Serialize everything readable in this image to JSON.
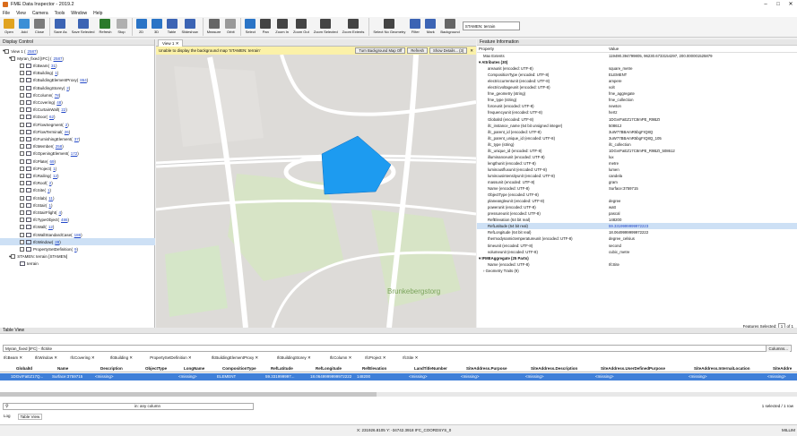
{
  "app": {
    "title": "FME Data Inspector - 2019.2",
    "win": [
      "–",
      "□",
      "✕"
    ]
  },
  "menu": [
    "File",
    "View",
    "Camera",
    "Tools",
    "Window",
    "Help"
  ],
  "toolbar": {
    "buttons": [
      {
        "label": "Open",
        "icon": "folder-open-icon",
        "color": "#e0a320"
      },
      {
        "label": "Add",
        "icon": "add-dataset-icon",
        "color": "#3b8fd6"
      },
      {
        "label": "Close",
        "icon": "close-dataset-icon",
        "color": "#7b7b7b"
      },
      {
        "label": "Save As",
        "icon": "save-as-icon",
        "color": "#3c64b4"
      },
      {
        "label": "Save Selected",
        "icon": "save-selected-icon",
        "color": "#3c64b4"
      },
      {
        "label": "Refresh",
        "icon": "refresh-icon",
        "color": "#2c7a2c"
      },
      {
        "label": "Stop",
        "icon": "stop-icon",
        "color": "#b0b0b0"
      },
      {
        "label": "2D",
        "icon": "2d-view-icon",
        "color": "#2a74c6"
      },
      {
        "label": "3D",
        "icon": "3d-view-icon",
        "color": "#2a74c6"
      },
      {
        "label": "Table",
        "icon": "table-icon",
        "color": "#3c64b4"
      },
      {
        "label": "Slideshow",
        "icon": "slideshow-icon",
        "color": "#3c64b4"
      },
      {
        "label": "Measure",
        "icon": "measure-icon",
        "color": "#666"
      },
      {
        "label": "Orbit",
        "icon": "orbit-icon",
        "color": "#999"
      },
      {
        "label": "Select",
        "icon": "select-icon",
        "color": "#2a74c6"
      },
      {
        "label": "Pan",
        "icon": "pan-icon",
        "color": "#444"
      },
      {
        "label": "Zoom In",
        "icon": "zoom-in-icon",
        "color": "#444"
      },
      {
        "label": "Zoom Out",
        "icon": "zoom-out-icon",
        "color": "#444"
      },
      {
        "label": "Zoom Selected",
        "icon": "zoom-selected-icon",
        "color": "#444"
      },
      {
        "label": "Zoom Extents",
        "icon": "zoom-extents-icon",
        "color": "#444"
      },
      {
        "label": "Select No Geometry",
        "icon": "no-geometry-icon",
        "color": "#444"
      },
      {
        "label": "Filter",
        "icon": "filter-icon",
        "color": "#3c64b4"
      },
      {
        "label": "Mark",
        "icon": "mark-icon",
        "color": "#3c64b4"
      },
      {
        "label": "Background",
        "icon": "background-icon",
        "color": "#666"
      }
    ],
    "bg_combo": "STAMEN: terrain"
  },
  "display_control": {
    "title": "Display Control",
    "view": "View 1 (",
    "view_count": "2587",
    "dataset": "Myran_fixed [IFC] (",
    "dataset_count": "2587",
    "items": [
      {
        "name": "IfcBeam",
        "count": "31"
      },
      {
        "name": "IfcBuilding",
        "count": "1"
      },
      {
        "name": "IfcBuildingElementProxy",
        "count": "864"
      },
      {
        "name": "IfcBuildingStorey",
        "count": "2"
      },
      {
        "name": "IfcColumn",
        "count": "78"
      },
      {
        "name": "IfcCovering",
        "count": "48"
      },
      {
        "name": "IfcCurtainWall",
        "count": "22"
      },
      {
        "name": "IfcDoor",
        "count": "62"
      },
      {
        "name": "IfcFlowSegment",
        "count": "2"
      },
      {
        "name": "IfcFlowTerminal",
        "count": "26"
      },
      {
        "name": "IfcFurnishingElement",
        "count": "37"
      },
      {
        "name": "IfcMember",
        "count": "258"
      },
      {
        "name": "IfcOpeningElement",
        "count": "172"
      },
      {
        "name": "IfcPlate",
        "count": "69"
      },
      {
        "name": "IfcProject",
        "count": "1"
      },
      {
        "name": "IfcRailing",
        "count": "12"
      },
      {
        "name": "IfcRoof",
        "count": "2"
      },
      {
        "name": "IfcSite",
        "count": "1"
      },
      {
        "name": "IfcSlab",
        "count": "11"
      },
      {
        "name": "IfcStair",
        "count": "1"
      },
      {
        "name": "IfcStairFlight",
        "count": "4"
      },
      {
        "name": "IfcTypeObject",
        "count": "486"
      },
      {
        "name": "IfcWall",
        "count": "12"
      },
      {
        "name": "IfcWallStandardCase",
        "count": "186"
      },
      {
        "name": "IfcWindow",
        "count": "28"
      },
      {
        "name": "PropertySetDefinition",
        "count": "9"
      }
    ],
    "stamen": "STAMEN: terrain [STAMEN]",
    "stamen_child": "terrain"
  },
  "map": {
    "tab": "View 1",
    "message": "Unable to display the background map 'STAMEN: terrain'",
    "btn_off": "Turn Background Map Off",
    "btn_refresh": "Refresh",
    "btn_details": "Show Details... (3)",
    "place": "Brunkebergstorg"
  },
  "feature_info": {
    "title": "Feature Information",
    "col_prop": "Property",
    "col_val": "Value",
    "rows": [
      {
        "k": "Max Extents",
        "v": "119490.394799805, 96230.6733154297, 200.000001525879",
        "l": 1
      },
      {
        "k": "▾ Attributes (30)",
        "v": "",
        "l": 0,
        "b": 1
      },
      {
        "k": "areaunit (encoded: UTF-8)",
        "v": "square_metre",
        "l": 2
      },
      {
        "k": "CompositionType (encoded: UTF-8)",
        "v": "ELEMENT",
        "l": 2
      },
      {
        "k": "electriccurrentunit (encoded: UTF-8)",
        "v": "ampere",
        "l": 2
      },
      {
        "k": "electricvoltageunit (encoded: UTF-8)",
        "v": "volt",
        "l": 2
      },
      {
        "k": "fme_geometry (string)",
        "v": "fme_aggregate",
        "l": 2
      },
      {
        "k": "fme_type (string)",
        "v": "fme_collection",
        "l": 2
      },
      {
        "k": "forceunit (encoded: UTF-8)",
        "v": "newton",
        "l": 2
      },
      {
        "k": "frequencyunit (encoded: UTF-8)",
        "v": "hertz",
        "l": 2
      },
      {
        "k": "GlobalId (encoded: UTF-8)",
        "v": "1DGvrFaEZ17C8mPE_R9BZI",
        "l": 2
      },
      {
        "k": "ifc_instance_name (64 bit unsigned integer)",
        "v": "508612",
        "l": 2
      },
      {
        "k": "ifc_parent_id (encoded: UTF-8)",
        "v": "3uW77BBAmR5bgFrQ8Q",
        "l": 2
      },
      {
        "k": "ifc_parent_unique_id (encoded: UTF-8)",
        "v": "3uW77BBAmR5bgFrQ8Q_105",
        "l": 2
      },
      {
        "k": "ifc_type (string)",
        "v": "ifc_collection",
        "l": 2
      },
      {
        "k": "ifc_unique_id (encoded: UTF-8)",
        "v": "1DGvrFaEZ17C8mPE_R9BZI_508612",
        "l": 2
      },
      {
        "k": "illuminanceunit (encoded: UTF-8)",
        "v": "lux",
        "l": 2
      },
      {
        "k": "lengthunit (encoded: UTF-8)",
        "v": "metre",
        "l": 2
      },
      {
        "k": "luminousfluxunit (encoded: UTF-8)",
        "v": "lumen",
        "l": 2
      },
      {
        "k": "luminousintensityunit (encoded: UTF-8)",
        "v": "candela",
        "l": 2
      },
      {
        "k": "massunit (encoded: UTF-8)",
        "v": "gram",
        "l": 2
      },
      {
        "k": "Name (encoded: UTF-8)",
        "v": "Surface:3759715",
        "l": 2
      },
      {
        "k": "ObjectType (encoded: UTF-8)",
        "v": "",
        "l": 2
      },
      {
        "k": "planeangleunit (encoded: UTF-8)",
        "v": "degree",
        "l": 2
      },
      {
        "k": "powerunit (encoded: UTF-8)",
        "v": "watt",
        "l": 2
      },
      {
        "k": "pressureunit (encoded: UTF-8)",
        "v": "pascal",
        "l": 2
      },
      {
        "k": "RefElevation (64 bit real)",
        "v": "148200",
        "l": 2
      },
      {
        "k": "RefLatitude (64 bit real)",
        "v": "59.3319999999972223",
        "l": 2,
        "s": 1
      },
      {
        "k": "RefLongitude (64 bit real)",
        "v": "18.0649999999972222",
        "l": 2
      },
      {
        "k": "thermodynamictemperatureunit (encoded: UTF-8)",
        "v": "degree_celsius",
        "l": 2
      },
      {
        "k": "timeunit (encoded: UTF-8)",
        "v": "second",
        "l": 2
      },
      {
        "k": "volumeunit (encoded: UTF-8)",
        "v": "cubic_metre",
        "l": 2
      },
      {
        "k": "▾ IFMEAggregate (25 Parts)",
        "v": "",
        "l": 0,
        "b": 1
      },
      {
        "k": "Name (encoded: UTF-8)",
        "v": "IfcSite",
        "l": 2
      },
      {
        "k": "› Geometry Traits (9)",
        "v": "",
        "l": 1
      }
    ],
    "selected_label": "Features Selected:",
    "sel_num": "1",
    "sel_of": "of 1"
  },
  "table_view": {
    "title": "Table View",
    "source": "Myran_fixed [IFC] - IfcSite",
    "columns_btn": "Columns...",
    "tabs": [
      "IfcBeam",
      "IfcWindow",
      "IfcCovering",
      "IfcBuilding",
      "PropertySetDefinition",
      "IfcBuildingElementProxy",
      "IfcBuildingStorey",
      "IfcColumn",
      "IfcProject",
      "IfcSite"
    ],
    "headers": [
      "GlobalId",
      "Name",
      "Description",
      "ObjectType",
      "LongName",
      "CompositionType",
      "RefLatitude",
      "RefLongitude",
      "RefElevation",
      "LandTitleNumber",
      "SiteAddress.Purpose",
      "SiteAddress.Description",
      "SiteAddress.UserDefinedPurpose",
      "SiteAddress.InternalLocation",
      "SiteAddre"
    ],
    "row": [
      "1DGvrFaEZ17Q...",
      "Surface:3759715",
      "<missing>",
      "",
      "<missing>",
      "ELEMENT",
      "59.331999997...",
      "18.0649999999972222",
      "148200",
      "<missing>",
      "<missing>",
      "<missing>",
      "<missing>",
      "<missing>",
      "<missing>"
    ],
    "search_in": "in: any column",
    "selected": "1 selected / 1 row"
  },
  "bottom_tabs": [
    "Log",
    "Table View"
  ],
  "status": {
    "coords": "X: 231926.8105  Y: -34742.3918  IFC_COORDSYS_0",
    "units": "MILLIM"
  }
}
